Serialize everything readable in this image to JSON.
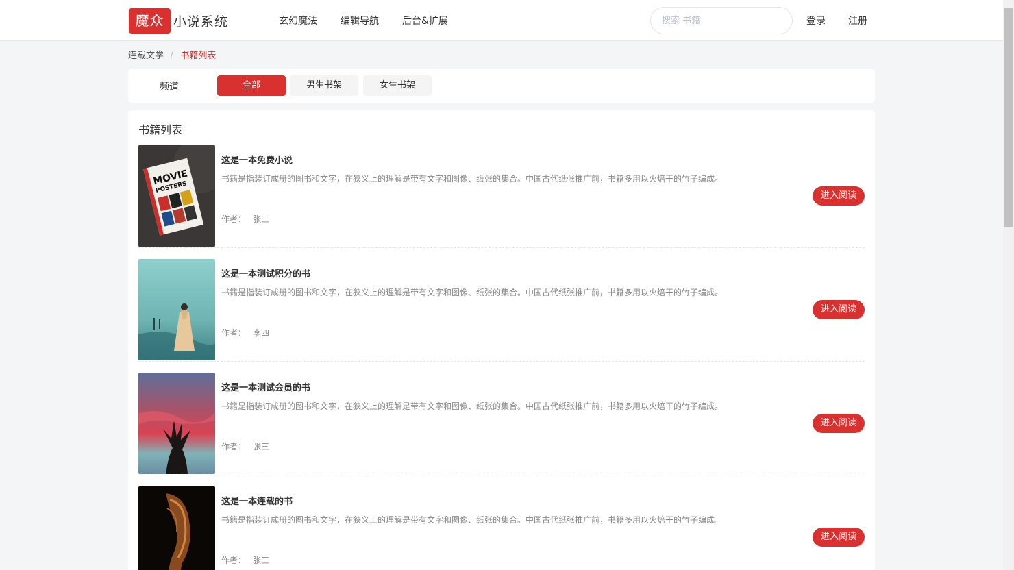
{
  "header": {
    "logo_mark": "魔众",
    "logo_text": "小说系统",
    "nav": [
      "玄幻魔法",
      "编辑导航",
      "后台&扩展"
    ],
    "search_placeholder": "搜索 书籍",
    "login": "登录",
    "register": "注册"
  },
  "breadcrumb": {
    "parent": "连载文学",
    "separator": "/",
    "current": "书籍列表"
  },
  "channel": {
    "label": "频道",
    "options": [
      "全部",
      "男生书架",
      "女生书架"
    ],
    "selected": "全部"
  },
  "list": {
    "title": "书籍列表",
    "author_prefix": "作者：",
    "read_label": "进入阅读",
    "books": [
      {
        "title": "这是一本免费小说",
        "description": "书籍是指装订成册的图书和文字，在狭义上的理解是带有文字和图像、纸张的集合。中国古代纸张推广前，书籍多用以火焙干的竹子编成。",
        "author": "张三",
        "cover": "movie-posters-book-cover"
      },
      {
        "title": "这是一本测试积分的书",
        "description": "书籍是指装订成册的图书和文字，在狭义上的理解是带有文字和图像、纸张的集合。中国古代纸张推广前，书籍多用以火焙干的竹子编成。",
        "author": "李四",
        "cover": "woman-on-beach-cover"
      },
      {
        "title": "这是一本测试会员的书",
        "description": "书籍是指装订成册的图书和文字，在狭义上的理解是带有文字和图像、纸张的集合。中国古代纸张推广前，书籍多用以火焙干的竹子编成。",
        "author": "张三",
        "cover": "silhouette-red-sky-cover"
      },
      {
        "title": "这是一本连载的书",
        "description": "书籍是指装订成册的图书和文字，在狭义上的理解是带有文字和图像、纸张的集合。中国古代纸张推广前，书籍多用以火焙干的竹子编成。",
        "author": "张三",
        "cover": "dark-portrait-cover"
      }
    ]
  },
  "colors": {
    "accent": "#d8312f",
    "page_bg": "#f4f5f6"
  }
}
